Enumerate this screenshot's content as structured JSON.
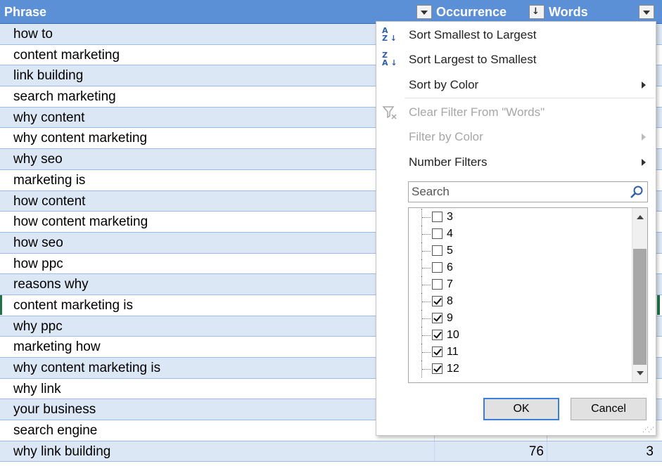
{
  "header": {
    "phrase": "Phrase",
    "occurrence": "Occurrence",
    "words": "Words"
  },
  "rows": [
    {
      "phrase": "how to"
    },
    {
      "phrase": "content marketing"
    },
    {
      "phrase": "link building"
    },
    {
      "phrase": "search marketing"
    },
    {
      "phrase": "why content"
    },
    {
      "phrase": "why content marketing"
    },
    {
      "phrase": "why seo"
    },
    {
      "phrase": "marketing is"
    },
    {
      "phrase": "how content"
    },
    {
      "phrase": "how content marketing"
    },
    {
      "phrase": "how seo"
    },
    {
      "phrase": "how ppc"
    },
    {
      "phrase": "reasons why"
    },
    {
      "phrase": "content marketing is"
    },
    {
      "phrase": "why ppc"
    },
    {
      "phrase": "marketing how"
    },
    {
      "phrase": "why content marketing is"
    },
    {
      "phrase": "why link"
    },
    {
      "phrase": "your business"
    },
    {
      "phrase": "search engine"
    },
    {
      "phrase": "why link building",
      "occurrence": "76",
      "words": "3"
    }
  ],
  "menu": {
    "sort_asc": "Sort Smallest to Largest",
    "sort_desc": "Sort Largest to Smallest",
    "sort_color": "Sort by Color",
    "clear_filter": "Clear Filter From \"Words\"",
    "filter_color": "Filter by Color",
    "number_filters": "Number Filters",
    "search_placeholder": "Search",
    "ok": "OK",
    "cancel": "Cancel"
  },
  "filter_items": [
    {
      "value": "3",
      "checked": false
    },
    {
      "value": "4",
      "checked": false
    },
    {
      "value": "5",
      "checked": false
    },
    {
      "value": "6",
      "checked": false
    },
    {
      "value": "7",
      "checked": false
    },
    {
      "value": "8",
      "checked": true
    },
    {
      "value": "9",
      "checked": true
    },
    {
      "value": "10",
      "checked": true
    },
    {
      "value": "11",
      "checked": true
    },
    {
      "value": "12",
      "checked": true
    }
  ],
  "colors": {
    "header_bg": "#5b8fd6",
    "band_row": "#dce7f5",
    "accent_green": "#217346"
  }
}
